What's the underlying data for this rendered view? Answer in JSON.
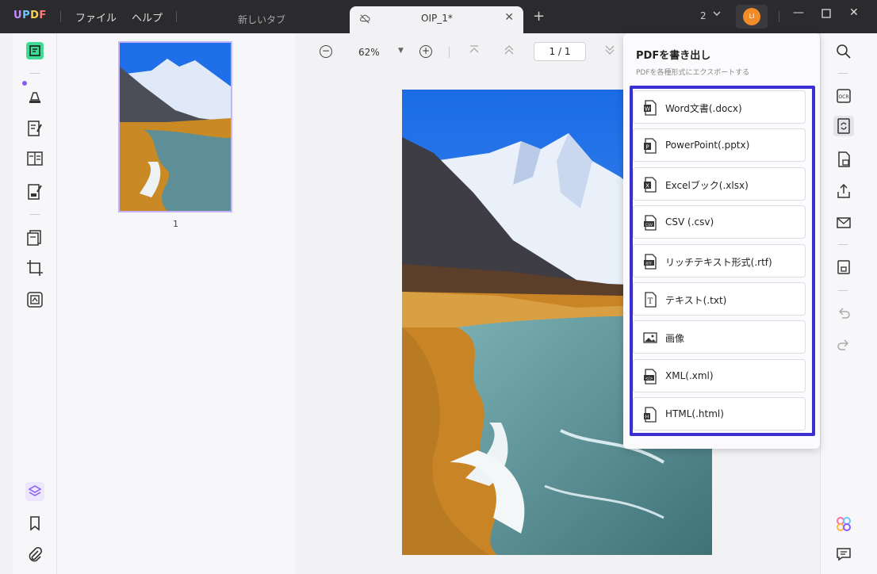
{
  "app": {
    "logo": "UPDF"
  },
  "menu": {
    "file": "ファイル",
    "help": "ヘルプ"
  },
  "tabs": {
    "inactive": "新しいタブ",
    "active": "OIP_1*"
  },
  "header": {
    "doc_count": "2",
    "avatar_initials": "LI"
  },
  "viewer": {
    "zoom": "62%",
    "page_display": "1 / 1"
  },
  "thumbnails": [
    {
      "page_number": "1"
    }
  ],
  "export": {
    "title": "PDFを書き出し",
    "subtitle": "PDFを各種形式にエクスポートする",
    "items": [
      {
        "label": "Word文書(.docx)",
        "icon": "word-icon",
        "badge": "W"
      },
      {
        "label": "PowerPoint(.pptx)",
        "icon": "powerpoint-icon",
        "badge": "P"
      },
      {
        "label": "Excelブック(.xlsx)",
        "icon": "excel-icon",
        "badge": "X"
      },
      {
        "label": "CSV (.csv)",
        "icon": "csv-icon",
        "badge": "CSV"
      },
      {
        "label": "リッチテキスト形式(.rtf)",
        "icon": "rtf-icon",
        "badge": "RTF"
      },
      {
        "label": "テキスト(.txt)",
        "icon": "text-icon",
        "badge": "T"
      },
      {
        "label": "画像",
        "icon": "image-icon",
        "badge": ""
      },
      {
        "label": "XML(.xml)",
        "icon": "xml-icon",
        "badge": "</>"
      },
      {
        "label": "HTML(.html)",
        "icon": "html-icon",
        "badge": "H"
      }
    ]
  },
  "colors": {
    "accent": "#3b2fd1",
    "titlebar": "#2b2b2e",
    "active_tool": "#3ddc97",
    "avatar": "#f28c28"
  }
}
